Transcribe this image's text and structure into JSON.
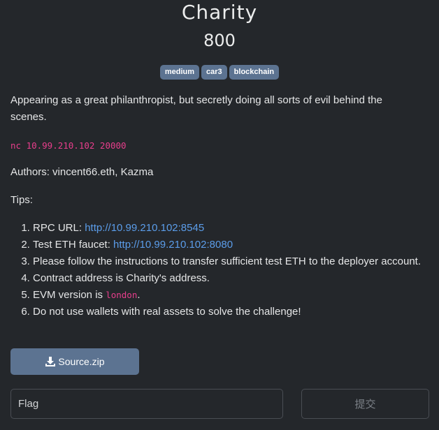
{
  "challenge": {
    "title": "Charity",
    "points": "800",
    "tags": [
      "medium",
      "car3",
      "blockchain"
    ],
    "description": "Appearing as a great philanthropist, but secretly doing all sorts of evil behind the scenes.",
    "command": "nc 10.99.210.102 20000",
    "authors": "Authors: vincent66.eth, Kazma",
    "tips_label": "Tips:",
    "tips": {
      "rpc_prefix": "RPC URL: ",
      "rpc_url": "http://10.99.210.102:8545",
      "faucet_prefix": "Test ETH faucet: ",
      "faucet_url": "http://10.99.210.102:8080",
      "instructions": "Please follow the instructions to transfer sufficient test ETH to the deployer account.",
      "contract": "Contract address is Charity's address.",
      "evm_prefix": "EVM version is ",
      "evm_version": "london",
      "evm_suffix": ".",
      "warning": "Do not use wallets with real assets to solve the challenge!"
    }
  },
  "download": {
    "label": "Source.zip",
    "icon": "download-icon"
  },
  "form": {
    "flag_placeholder": "Flag",
    "submit_label": "提交"
  },
  "colors": {
    "background": "#24272b",
    "tag": "#5c7391",
    "link": "#5b9dea",
    "code": "#e83e8c"
  }
}
